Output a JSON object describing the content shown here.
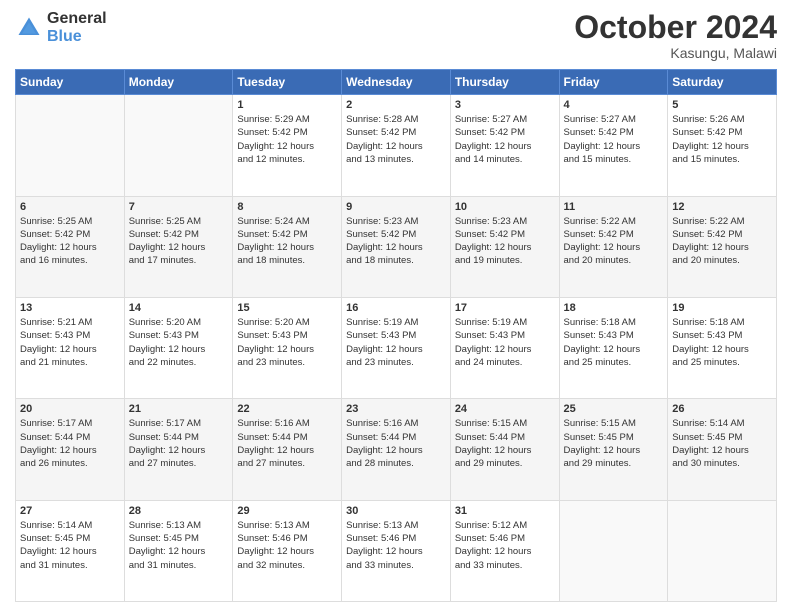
{
  "logo": {
    "general": "General",
    "blue": "Blue"
  },
  "header": {
    "month": "October 2024",
    "location": "Kasungu, Malawi"
  },
  "weekdays": [
    "Sunday",
    "Monday",
    "Tuesday",
    "Wednesday",
    "Thursday",
    "Friday",
    "Saturday"
  ],
  "weeks": [
    [
      {
        "day": "",
        "info": ""
      },
      {
        "day": "",
        "info": ""
      },
      {
        "day": "1",
        "info": "Sunrise: 5:29 AM\nSunset: 5:42 PM\nDaylight: 12 hours\nand 12 minutes."
      },
      {
        "day": "2",
        "info": "Sunrise: 5:28 AM\nSunset: 5:42 PM\nDaylight: 12 hours\nand 13 minutes."
      },
      {
        "day": "3",
        "info": "Sunrise: 5:27 AM\nSunset: 5:42 PM\nDaylight: 12 hours\nand 14 minutes."
      },
      {
        "day": "4",
        "info": "Sunrise: 5:27 AM\nSunset: 5:42 PM\nDaylight: 12 hours\nand 15 minutes."
      },
      {
        "day": "5",
        "info": "Sunrise: 5:26 AM\nSunset: 5:42 PM\nDaylight: 12 hours\nand 15 minutes."
      }
    ],
    [
      {
        "day": "6",
        "info": "Sunrise: 5:25 AM\nSunset: 5:42 PM\nDaylight: 12 hours\nand 16 minutes."
      },
      {
        "day": "7",
        "info": "Sunrise: 5:25 AM\nSunset: 5:42 PM\nDaylight: 12 hours\nand 17 minutes."
      },
      {
        "day": "8",
        "info": "Sunrise: 5:24 AM\nSunset: 5:42 PM\nDaylight: 12 hours\nand 18 minutes."
      },
      {
        "day": "9",
        "info": "Sunrise: 5:23 AM\nSunset: 5:42 PM\nDaylight: 12 hours\nand 18 minutes."
      },
      {
        "day": "10",
        "info": "Sunrise: 5:23 AM\nSunset: 5:42 PM\nDaylight: 12 hours\nand 19 minutes."
      },
      {
        "day": "11",
        "info": "Sunrise: 5:22 AM\nSunset: 5:42 PM\nDaylight: 12 hours\nand 20 minutes."
      },
      {
        "day": "12",
        "info": "Sunrise: 5:22 AM\nSunset: 5:42 PM\nDaylight: 12 hours\nand 20 minutes."
      }
    ],
    [
      {
        "day": "13",
        "info": "Sunrise: 5:21 AM\nSunset: 5:43 PM\nDaylight: 12 hours\nand 21 minutes."
      },
      {
        "day": "14",
        "info": "Sunrise: 5:20 AM\nSunset: 5:43 PM\nDaylight: 12 hours\nand 22 minutes."
      },
      {
        "day": "15",
        "info": "Sunrise: 5:20 AM\nSunset: 5:43 PM\nDaylight: 12 hours\nand 23 minutes."
      },
      {
        "day": "16",
        "info": "Sunrise: 5:19 AM\nSunset: 5:43 PM\nDaylight: 12 hours\nand 23 minutes."
      },
      {
        "day": "17",
        "info": "Sunrise: 5:19 AM\nSunset: 5:43 PM\nDaylight: 12 hours\nand 24 minutes."
      },
      {
        "day": "18",
        "info": "Sunrise: 5:18 AM\nSunset: 5:43 PM\nDaylight: 12 hours\nand 25 minutes."
      },
      {
        "day": "19",
        "info": "Sunrise: 5:18 AM\nSunset: 5:43 PM\nDaylight: 12 hours\nand 25 minutes."
      }
    ],
    [
      {
        "day": "20",
        "info": "Sunrise: 5:17 AM\nSunset: 5:44 PM\nDaylight: 12 hours\nand 26 minutes."
      },
      {
        "day": "21",
        "info": "Sunrise: 5:17 AM\nSunset: 5:44 PM\nDaylight: 12 hours\nand 27 minutes."
      },
      {
        "day": "22",
        "info": "Sunrise: 5:16 AM\nSunset: 5:44 PM\nDaylight: 12 hours\nand 27 minutes."
      },
      {
        "day": "23",
        "info": "Sunrise: 5:16 AM\nSunset: 5:44 PM\nDaylight: 12 hours\nand 28 minutes."
      },
      {
        "day": "24",
        "info": "Sunrise: 5:15 AM\nSunset: 5:44 PM\nDaylight: 12 hours\nand 29 minutes."
      },
      {
        "day": "25",
        "info": "Sunrise: 5:15 AM\nSunset: 5:45 PM\nDaylight: 12 hours\nand 29 minutes."
      },
      {
        "day": "26",
        "info": "Sunrise: 5:14 AM\nSunset: 5:45 PM\nDaylight: 12 hours\nand 30 minutes."
      }
    ],
    [
      {
        "day": "27",
        "info": "Sunrise: 5:14 AM\nSunset: 5:45 PM\nDaylight: 12 hours\nand 31 minutes."
      },
      {
        "day": "28",
        "info": "Sunrise: 5:13 AM\nSunset: 5:45 PM\nDaylight: 12 hours\nand 31 minutes."
      },
      {
        "day": "29",
        "info": "Sunrise: 5:13 AM\nSunset: 5:46 PM\nDaylight: 12 hours\nand 32 minutes."
      },
      {
        "day": "30",
        "info": "Sunrise: 5:13 AM\nSunset: 5:46 PM\nDaylight: 12 hours\nand 33 minutes."
      },
      {
        "day": "31",
        "info": "Sunrise: 5:12 AM\nSunset: 5:46 PM\nDaylight: 12 hours\nand 33 minutes."
      },
      {
        "day": "",
        "info": ""
      },
      {
        "day": "",
        "info": ""
      }
    ]
  ]
}
